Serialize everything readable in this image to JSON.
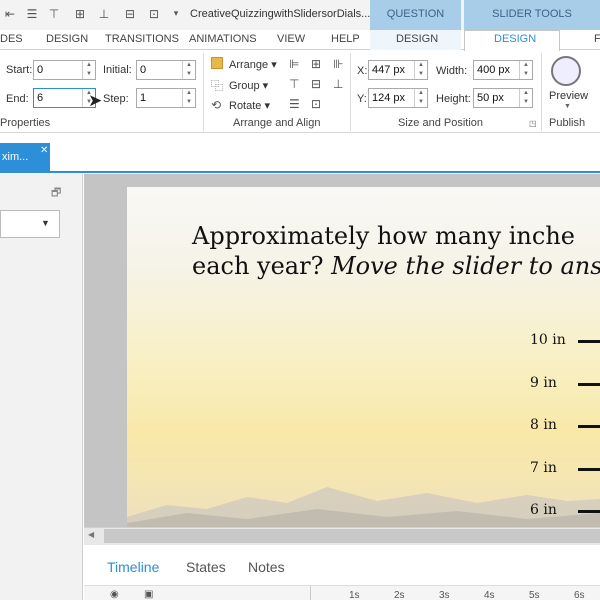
{
  "window": {
    "document_title": "CreativeQuizzingwithSlidersorDials...",
    "context_tabs": {
      "question_tools": "QUESTION TOOLS",
      "slider_tools": "SLIDER TOOLS"
    }
  },
  "quick_access": [
    "align-left-icon",
    "distribute-icon",
    "align-top-icon",
    "align-middle-icon",
    "align-bottom-icon",
    "grid-icon",
    "center-icon",
    "more-icon"
  ],
  "ribbon_tabs": {
    "slides": "DES",
    "design": "DESIGN",
    "transitions": "TRANSITIONS",
    "animations": "ANIMATIONS",
    "view": "VIEW",
    "help": "HELP",
    "question_design": "DESIGN",
    "slider_design": "DESIGN",
    "format": "F"
  },
  "properties": {
    "start_label": "Start:",
    "start_value": "0",
    "end_label": "End:",
    "end_value": "6",
    "initial_label": "Initial:",
    "initial_value": "0",
    "step_label": "Step:",
    "step_value": "1",
    "group_label": "Properties"
  },
  "arrange": {
    "arrange_label": "Arrange",
    "group_label": "Group",
    "rotate_label": "Rotate",
    "group_title": "Arrange and Align"
  },
  "size_position": {
    "x_label": "X:",
    "x_value": "447 px",
    "y_label": "Y:",
    "y_value": "124 px",
    "width_label": "Width:",
    "width_value": "400 px",
    "height_label": "Height:",
    "height_value": "50 px",
    "group_title": "Size and Position"
  },
  "publish": {
    "preview_label": "Preview",
    "group_title": "Publish"
  },
  "doc_tab": {
    "label": "xim..."
  },
  "slide": {
    "question_line1": "Approximately how many inche",
    "question_line2_normal": "each year? ",
    "question_line2_italic": "Move the slider to ans",
    "scale": [
      {
        "label": "10 in"
      },
      {
        "label": "9 in"
      },
      {
        "label": "8 in"
      },
      {
        "label": "7 in"
      },
      {
        "label": "6 in"
      }
    ]
  },
  "bottom_tabs": {
    "timeline": "Timeline",
    "states": "States",
    "notes": "Notes"
  },
  "ruler": [
    "1s",
    "2s",
    "3s",
    "4s",
    "5s",
    "6s"
  ],
  "colors": {
    "accent": "#2c8fd8",
    "context_tab": "#a8cde8"
  }
}
